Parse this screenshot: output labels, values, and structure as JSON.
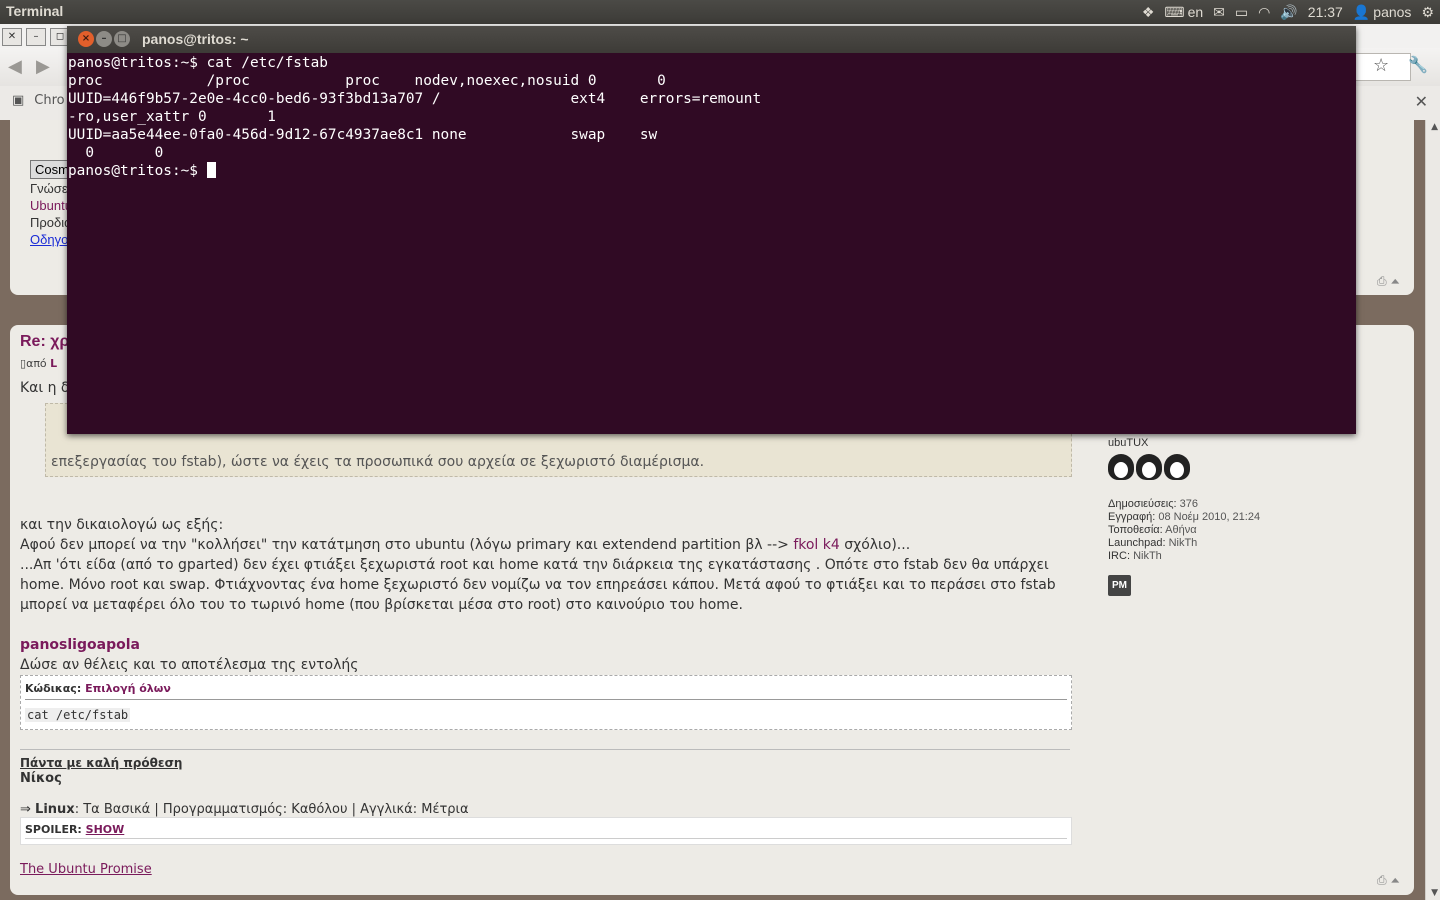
{
  "top_panel": {
    "app_title": "Terminal",
    "keyboard_layout": "en",
    "clock": "21:37",
    "user": "panos"
  },
  "browser": {
    "bookmark_label": "Chro",
    "page": {
      "prev_post": {
        "button": "Cosmo",
        "line1": "Γνώσεις",
        "line2": "Ubuntu",
        "line3": "Προδιαγ",
        "line4": "Οδηγοί"
      },
      "post": {
        "title": "Re: χρ",
        "by_prefix": "από",
        "by_user": "L",
        "intro": "Και η δ",
        "quote_visible_text": "επεξεργασίας του fstab), ώστε να έχεις τα προσωπικά σου αρχεία σε ξεχωριστό διαμέρισμα.",
        "para1": "και την δικαιολογώ ως εξής:",
        "para2_prefix": "Αφού δεν μπορεί να την \"κολλήσει\" την κατάτμηση στο ubuntu (λόγω primary και extendend partition βλ --> ",
        "para2_link": "fkol k4",
        "para2_suffix": " σχόλιο)...",
        "para3": "...Απ 'ότι είδα (από το gparted) δεν έχει φτιάξει ξεχωριστά root και home κατά την διάρκεια της εγκατάστασης . Οπότε στο fstab δεν θα υπάρχει home. Μόνο root και swap. Φτιάχνοντας ένα home ξεχωριστό δεν νομίζω να τον επηρεάσει κάπου. Μετά αφού το φτιάξει και το περάσει στο fstab μπορεί να μεταφέρει όλο του το τωρινό home (που βρίσκεται μέσα στο root) στο καινούριο του home.",
        "mention": "panosligoapola",
        "ask": "Δώσε αν θέλεις και το αποτέλεσμα της εντολής",
        "code_label": "Κώδικας:",
        "code_select_all": "Επιλογή όλων",
        "code": "cat /etc/fstab",
        "sig_link": "Πάντα με καλή πρόθεση",
        "sig_name": "Νίκος",
        "sig_arrow": "⇒",
        "sig_linux_label": "Linux",
        "sig_linux_value": ": Τα Βασικά",
        "sig_prog": "Προγραμματισμός: Καθόλου",
        "sig_eng": "Αγγλικά: Μέτρια",
        "spoiler_label": "SPOILER:",
        "spoiler_show": "SHOW",
        "promise": "The Ubuntu Promise"
      },
      "profile": {
        "rank": "ubuTUX",
        "posts_label": "Δημοσιεύσεις:",
        "posts": "376",
        "joined_label": "Εγγραφή:",
        "joined": "08 Νοέμ 2010, 21:24",
        "location_label": "Τοποθεσία:",
        "location": "Αθήνα",
        "launchpad_label": "Launchpad:",
        "launchpad": "NikTh",
        "irc_label": "IRC:",
        "irc": "NikTh",
        "pm": "PM"
      }
    }
  },
  "terminal": {
    "title": "panos@tritos: ~",
    "lines": [
      "panos@tritos:~$ cat /etc/fstab",
      "proc            /proc           proc    nodev,noexec,nosuid 0       0",
      "UUID=446f9b57-2e0e-4cc0-bed6-93f3bd13a707 /               ext4    errors=remount",
      "-ro,user_xattr 0       1",
      "UUID=aa5e44ee-0fa0-456d-9d12-67c4937ae8c1 none            swap    sw",
      "  0       0"
    ],
    "prompt": "panos@tritos:~$ "
  }
}
